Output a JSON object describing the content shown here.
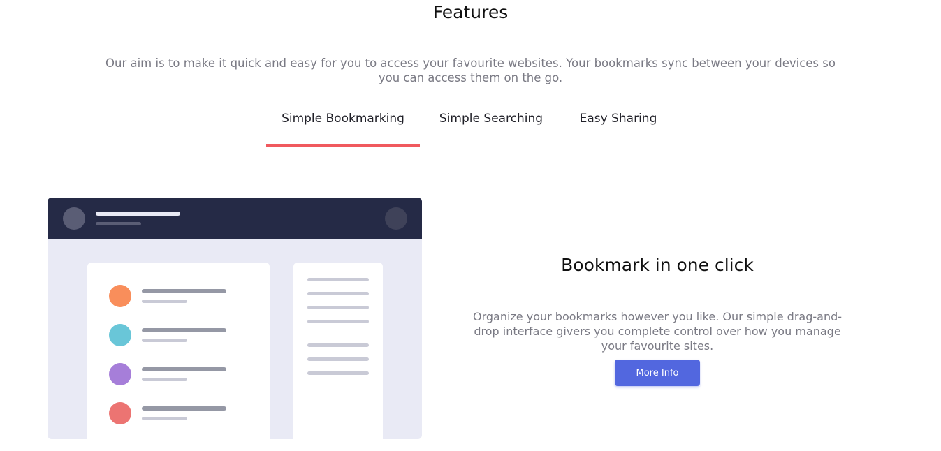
{
  "section": {
    "title": "Features",
    "intro": "Our aim is to make it quick and easy for you to access your favourite websites. Your bookmarks sync between your devices so you can access them on the go."
  },
  "tabs": [
    {
      "label": "Simple Bookmarking",
      "active": true
    },
    {
      "label": "Simple Searching",
      "active": false
    },
    {
      "label": "Easy Sharing",
      "active": false
    }
  ],
  "feature": {
    "title": "Bookmark in one click",
    "description": "Organize your bookmarks however you like. Our simple drag-and-drop interface givers you complete control over how you manage your favourite sites.",
    "button_label": "More Info"
  },
  "colors": {
    "accent_red": "#f0595e",
    "button_blue": "#5267df",
    "header_navy": "#252a46",
    "illustration_bg": "#e9eaf5",
    "dot_orange": "#f98e5b",
    "dot_teal": "#69c6d8",
    "dot_purple": "#a67ed9",
    "dot_red": "#ec7472"
  }
}
